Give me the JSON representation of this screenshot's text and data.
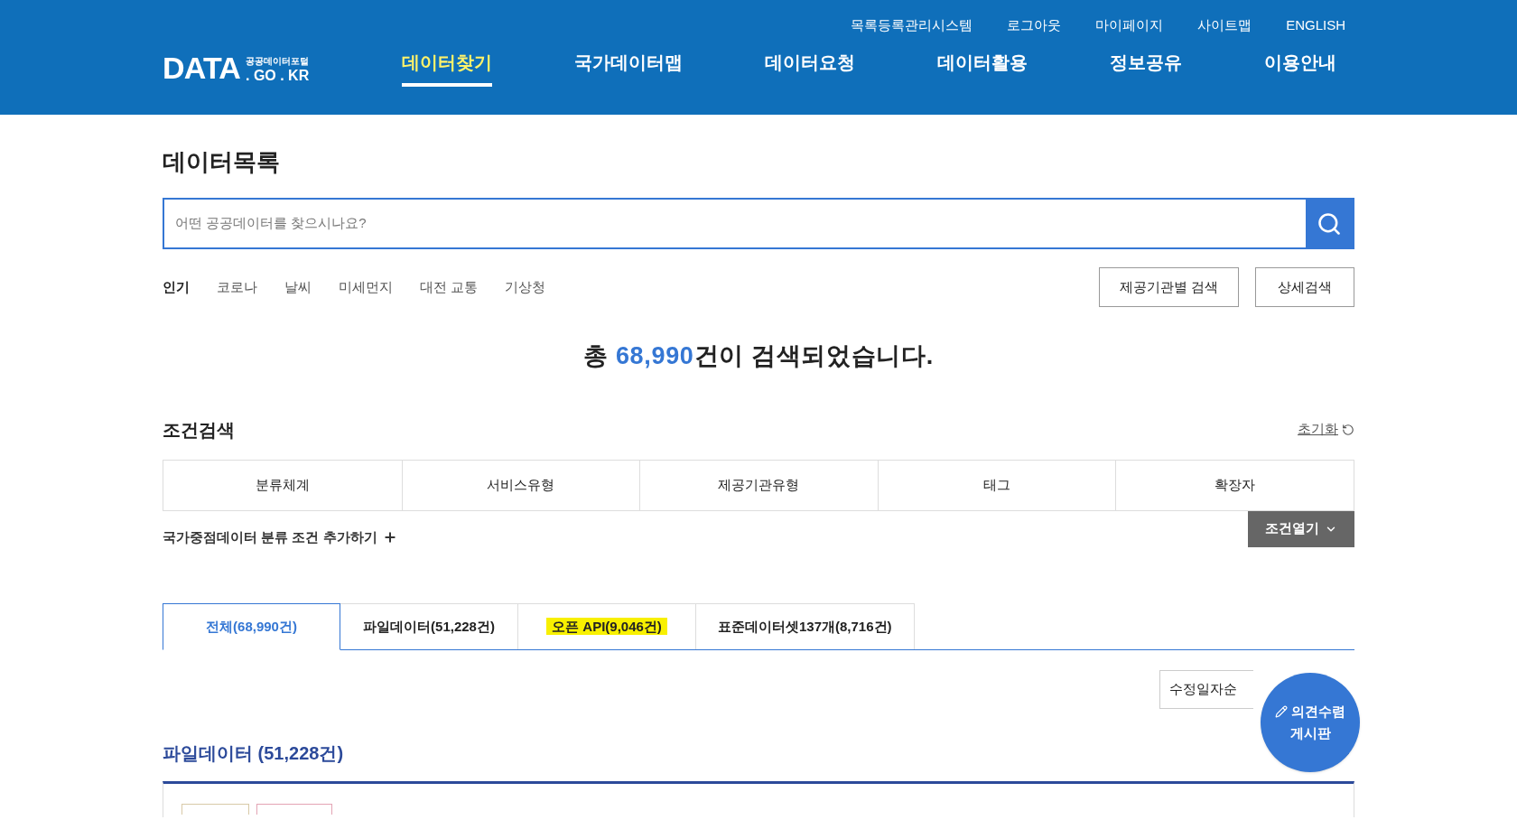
{
  "header": {
    "utility_links": [
      "목록등록관리시스템",
      "로그아웃",
      "마이페이지",
      "사이트맵",
      "ENGLISH"
    ],
    "logo": {
      "main": "DATA",
      "sub": "공공데이터포털",
      "domain": ". GO . KR"
    },
    "nav": [
      {
        "label": "데이터찾기",
        "selected": true
      },
      {
        "label": "국가데이터맵",
        "selected": false
      },
      {
        "label": "데이터요청",
        "selected": false
      },
      {
        "label": "데이터활용",
        "selected": false
      },
      {
        "label": "정보공유",
        "selected": false
      },
      {
        "label": "이용안내",
        "selected": false
      }
    ]
  },
  "page_title": "데이터목록",
  "search": {
    "placeholder": "어떤 공공데이터를 찾으시나요?"
  },
  "popular": {
    "label": "인기",
    "keywords": [
      "코로나",
      "날씨",
      "미세먼지",
      "대전 교통",
      "기상청"
    ]
  },
  "search_buttons": [
    "제공기관별 검색",
    "상세검색"
  ],
  "result": {
    "prefix": "총 ",
    "count": "68,990",
    "suffix": "건이 검색되었습니다."
  },
  "condition_search": {
    "title": "조건검색",
    "reset": "초기화",
    "columns": [
      "분류체계",
      "서비스유형",
      "제공기관유형",
      "태그",
      "확장자"
    ],
    "add_condition": "국가중점데이터 분류 조건 추가하기",
    "open_button": "조건열기"
  },
  "tabs": [
    {
      "label": "전체(68,990건)",
      "selected": true,
      "highlighted": false
    },
    {
      "label": "파일데이터(51,228건)",
      "selected": false,
      "highlighted": false
    },
    {
      "label": "오픈 API(9,046건)",
      "selected": false,
      "highlighted": true
    },
    {
      "label": "표준데이터셋137개(8,716건)",
      "selected": false,
      "highlighted": false
    }
  ],
  "sort": {
    "value": "수정일자순"
  },
  "section": {
    "title": "파일데이터",
    "count": "(51,228건)"
  },
  "floating_button": {
    "line1": "의견수렴",
    "line2": "게시판"
  }
}
